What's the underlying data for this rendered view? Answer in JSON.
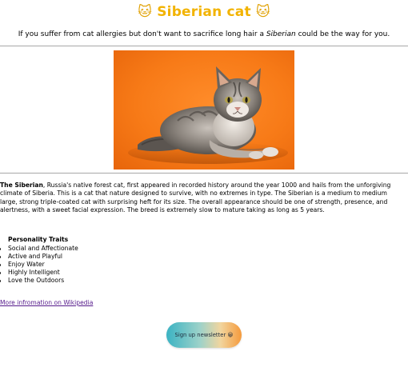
{
  "header": {
    "emoji_left": "🐱",
    "title": "Siberian cat",
    "emoji_right": "🐱"
  },
  "intro": {
    "before": "If you suffer from cat allergies but don't want to sacrifice long hair a ",
    "emphasis": "Siberian",
    "after": " could be the way for you."
  },
  "image": {
    "subject": "long-haired tabby kitten lying on orange background"
  },
  "description": {
    "lead": "The Siberian",
    "body": ", Russia's native forest cat, first appeared in recorded history around the year 1000 and hails from the unforgiving climate of Siberia. This is a cat that nature designed to survive, with no extremes in type. The Siberian is a medium to medium large, strong triple-coated cat with surprising heft for its size. The overall appearance should be one of strength, presence, and alertness, with a sweet facial expression. The breed is extremely slow to mature taking as long as 5 years."
  },
  "personality": {
    "title": "Personality Traits",
    "items": [
      "Social and Affectionate",
      "Active and Playful",
      "Enjoy Water",
      "Highly Intelligent",
      "Love the Outdoors"
    ]
  },
  "links": {
    "wikipedia": "More infromation on Wikipedia"
  },
  "signup": {
    "label": "Sign up newsletter 😀"
  },
  "colors": {
    "title": "#f2b300",
    "link_visited": "#551a8b",
    "photo_background": "#f77a17"
  }
}
